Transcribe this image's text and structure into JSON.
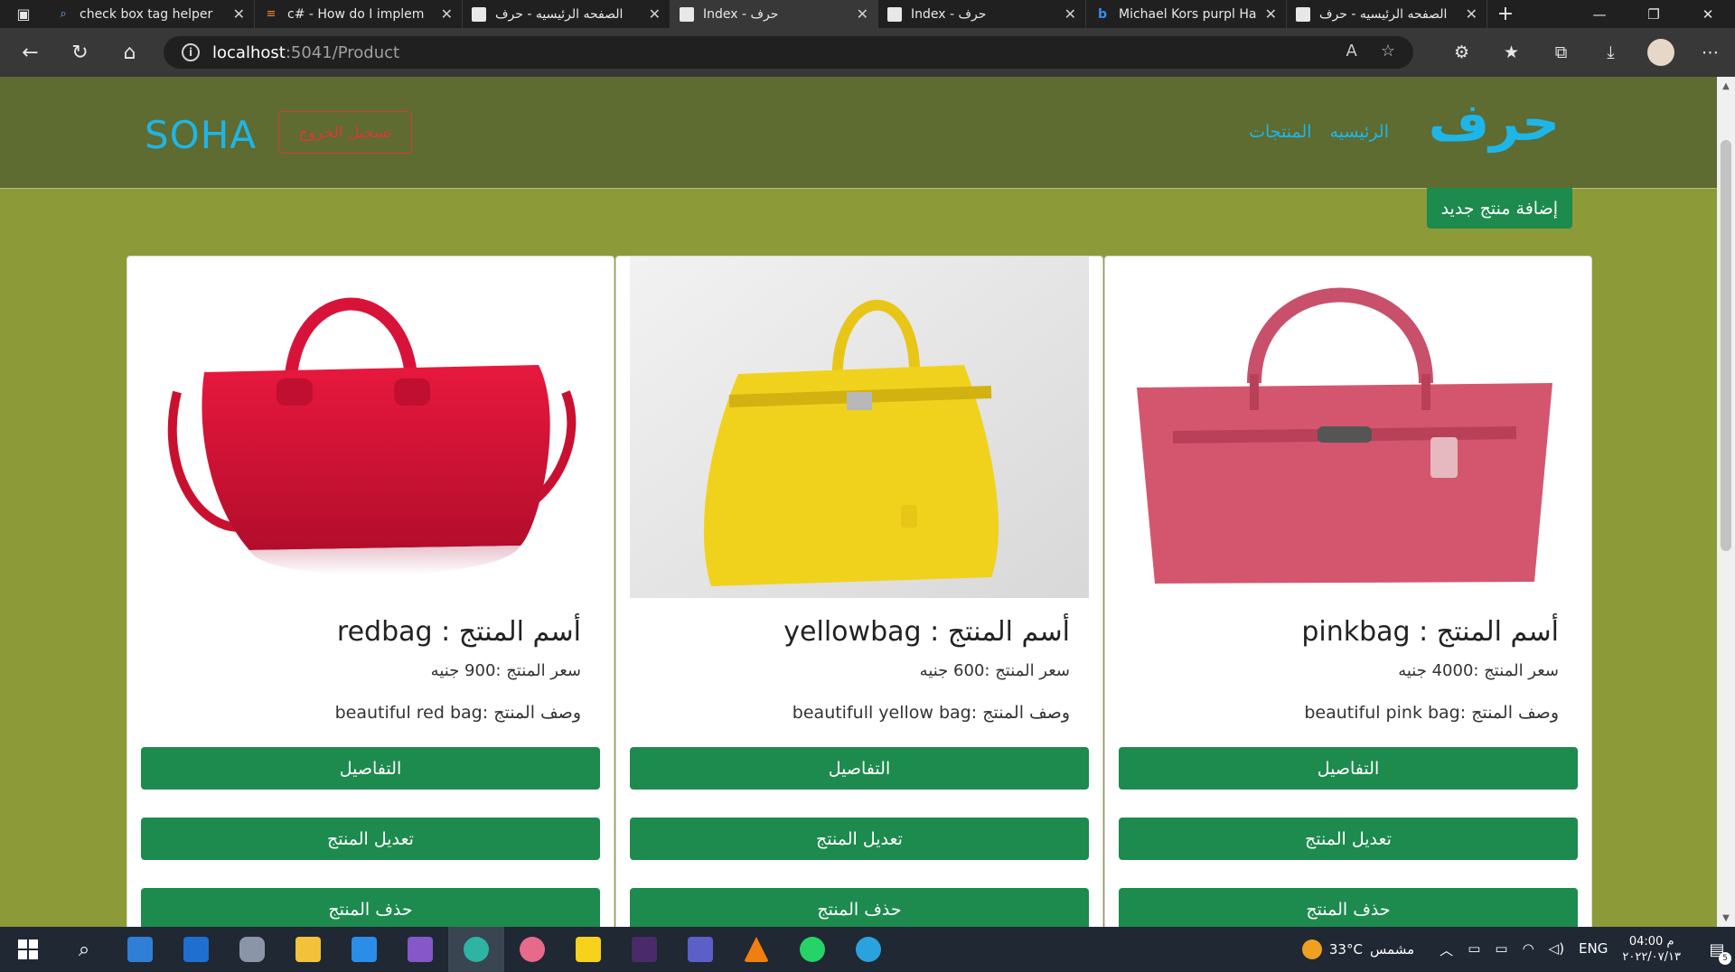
{
  "browser": {
    "tabs": [
      {
        "title": "check box tag helper",
        "favicon": "search-icon"
      },
      {
        "title": "c# - How do I implem",
        "favicon": "stackoverflow-icon"
      },
      {
        "title": "الصفحه الرئيسيه - حرف",
        "favicon": "page-icon"
      },
      {
        "title": "Index - حرف",
        "favicon": "page-icon",
        "active": true
      },
      {
        "title": "Index - حرف",
        "favicon": "page-icon"
      },
      {
        "title": "Michael Kors purpl Ha",
        "favicon": "bing-icon"
      },
      {
        "title": "الصفحه الرئيسيه - حرف",
        "favicon": "page-icon"
      }
    ],
    "url_host": "localhost",
    "url_path": ":5041/Product"
  },
  "site": {
    "brand": "حرف",
    "nav_home": "الرئيسيه",
    "nav_products": "المنتجات",
    "user": "SOHA",
    "logout": "تسجيل الخروج",
    "add_product": "إضافة منتج جديد"
  },
  "products": [
    {
      "title": "أسم المنتج : redbag",
      "price": "سعر المنتج :900 جنيه",
      "desc": "وصف المنتج :beautiful red bag",
      "details": "التفاصيل",
      "edit": "تعديل المنتج",
      "delete": "حذف المنتج",
      "color": "#d8133a"
    },
    {
      "title": "أسم المنتج : yellowbag",
      "price": "سعر المنتج :600 جنيه",
      "desc": "وصف المنتج :beautifull yellow bag",
      "details": "التفاصيل",
      "edit": "تعديل المنتج",
      "delete": "حذف المنتج",
      "color": "#f0d21c"
    },
    {
      "title": "أسم المنتج : pinkbag",
      "price": "سعر المنتج :4000 جنيه",
      "desc": "وصف المنتج :beautiful pink bag",
      "details": "التفاصيل",
      "edit": "تعديل المنتج",
      "delete": "حذف المنتج",
      "color": "#d4566e"
    }
  ],
  "taskbar": {
    "temperature": "33°C",
    "weather_text": "مشمس",
    "language": "ENG",
    "time": "04:00 م",
    "date": "٢٠٢٢/٠٧/١٣",
    "notification_count": "5"
  }
}
